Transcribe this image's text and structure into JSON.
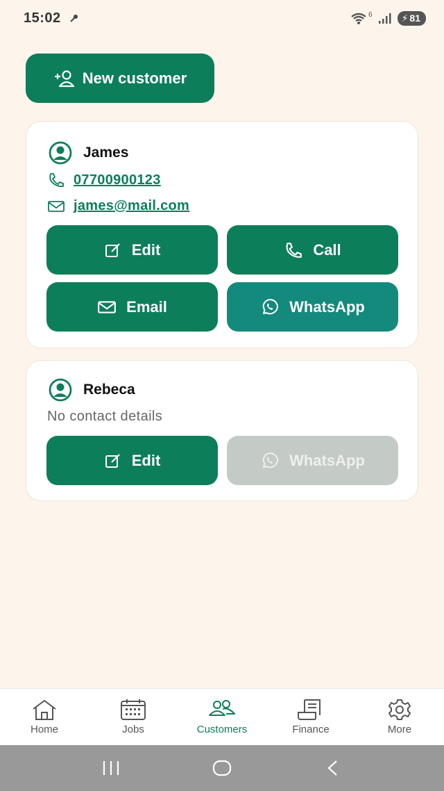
{
  "status_bar": {
    "time": "15:02",
    "battery": "81",
    "wifi_badge": "6"
  },
  "new_customer_button": {
    "label": "New customer",
    "icon": "add-user-icon"
  },
  "customers": [
    {
      "name": "James",
      "phone": "07700900123",
      "email": "james@mail.com",
      "actions": {
        "edit": "Edit",
        "call": "Call",
        "email": "Email",
        "whatsapp": "WhatsApp"
      }
    },
    {
      "name": "Rebeca",
      "no_contact": "No contact details",
      "actions": {
        "edit": "Edit",
        "whatsapp": "WhatsApp"
      }
    }
  ],
  "bottom_nav": {
    "items": [
      {
        "label": "Home",
        "icon": "home-icon"
      },
      {
        "label": "Jobs",
        "icon": "calendar-icon"
      },
      {
        "label": "Customers",
        "icon": "customers-icon",
        "active": true
      },
      {
        "label": "Finance",
        "icon": "receipt-icon"
      },
      {
        "label": "More",
        "icon": "gear-icon"
      }
    ]
  },
  "colors": {
    "primary": "#0c7e5a",
    "whatsapp": "#148a7d",
    "disabled": "#c4cac6",
    "background": "#fdf5ec"
  }
}
